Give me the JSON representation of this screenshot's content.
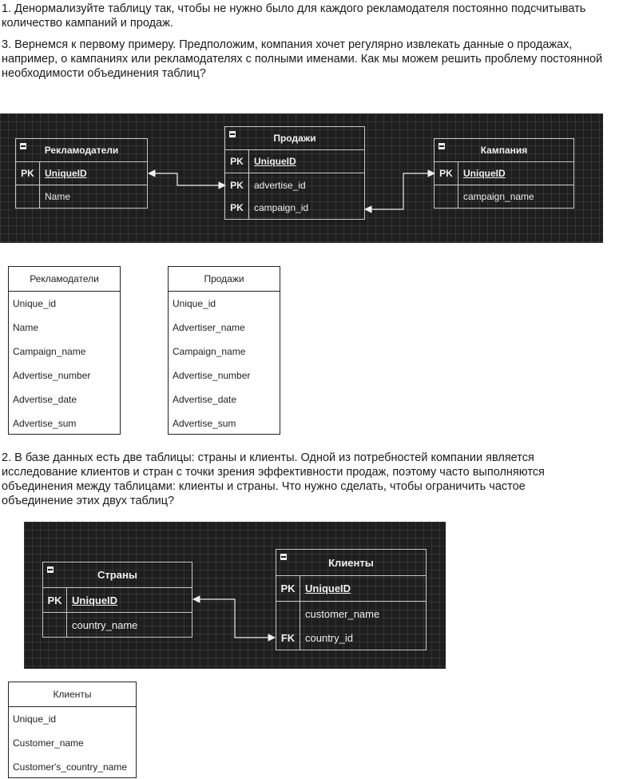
{
  "paragraphs": {
    "p1": "1. Денормализуйте таблицу так, чтобы не нужно было для каждого рекламодателя постоянно подсчитывать количество кампаний и продаж.",
    "p3": "3. Вернемся к первому примеру. Предположим, компания хочет регулярно извлекать данные о продажах, например, о кампаниях или рекламодателях с полными именами. Как мы можем решить проблему постоянной необходимости объединения таблиц?",
    "p2": "2. В базе данных есть две таблицы: страны и клиенты. Одной из потребностей компании является исследование клиентов и стран с точки зрения эффективности продаж, поэтому часто выполняются объединения между таблицами: клиенты и страны. Что нужно сделать, чтобы ограничить частое объединение этих двух таблиц?"
  },
  "diagram1": {
    "advertisers": {
      "title": "Рекламодатели",
      "rows": [
        {
          "key": "PK",
          "field": "UniqueID"
        },
        {
          "key": "",
          "field": "Name"
        }
      ]
    },
    "sales": {
      "title": "Продажи",
      "rows": [
        {
          "key": "PK",
          "field": "UniqueID"
        },
        {
          "key": "PK",
          "field": "advertise_id"
        },
        {
          "key": "PK",
          "field": "campaign_id"
        }
      ]
    },
    "campaign": {
      "title": "Кампания",
      "rows": [
        {
          "key": "PK",
          "field": "UniqueID"
        },
        {
          "key": "",
          "field": "campaign_name"
        }
      ]
    }
  },
  "denorm_tables": {
    "advertisers": {
      "title": "Рекламодатели",
      "fields": [
        "Unique_id",
        "Name",
        "Campaign_name",
        "Advertise_number",
        "Advertise_date",
        "Advertise_sum"
      ]
    },
    "sales": {
      "title": "Продажи",
      "fields": [
        "Unique_id",
        "Advertiser_name",
        "Campaign_name",
        "Advertise_number",
        "Advertise_date",
        "Advertise_sum"
      ]
    }
  },
  "diagram2": {
    "countries": {
      "title": "Страны",
      "rows": [
        {
          "key": "PK",
          "field": "UniqueID"
        },
        {
          "key": "",
          "field": "country_name"
        }
      ]
    },
    "clients": {
      "title": "Клиенты",
      "rows": [
        {
          "key": "PK",
          "field": "UniqueID"
        },
        {
          "key": "",
          "field": "customer_name"
        },
        {
          "key": "FK",
          "field": "country_id"
        }
      ]
    }
  },
  "clients_table": {
    "title": "Клиенты",
    "fields": [
      "Unique_id",
      "Customer_name",
      "Customer's_country_name"
    ]
  }
}
